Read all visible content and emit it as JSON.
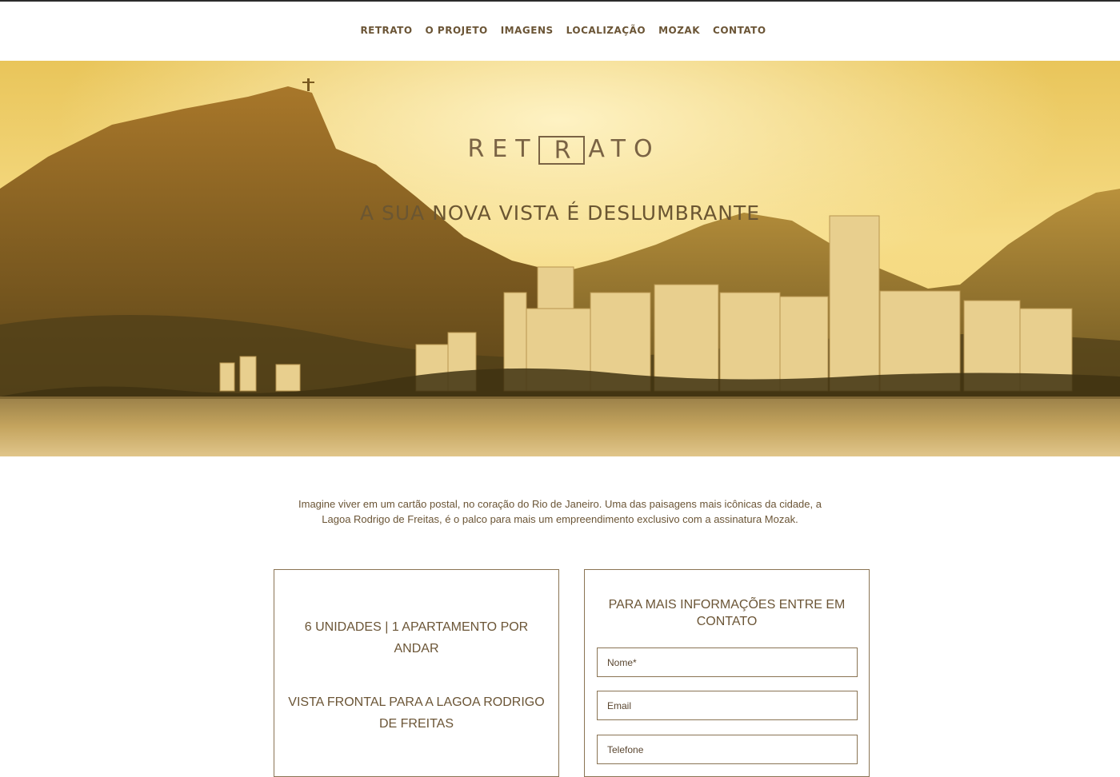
{
  "nav": {
    "items": [
      "RETRATO",
      "O PROJETO",
      "IMAGENS",
      "LOCALIZAÇÃO",
      "MOZAK",
      "CONTATO"
    ]
  },
  "hero": {
    "logo_left": "RET",
    "logo_boxed": "R",
    "logo_right": "ATO",
    "tagline": "A SUA NOVA VISTA É DESLUMBRANTE"
  },
  "intro": {
    "line1": "Imagine viver em um cartão postal, no coração do Rio de Janeiro. Uma das paisagens mais icônicas da cidade, a",
    "line2": "Lagoa Rodrigo de Freitas, é o palco para mais um empreendimento exclusivo com a assinatura Mozak."
  },
  "features": {
    "units": "6 UNIDADES | 1 APARTAMENTO POR ANDAR",
    "view": "VISTA FRONTAL PARA A LAGOA RODRIGO DE FREITAS"
  },
  "contact_form": {
    "title": "PARA MAIS INFORMAÇÕES ENTRE EM CONTATO",
    "name_placeholder": "Nome*",
    "email_placeholder": "Email",
    "phone_placeholder": "Telefone"
  },
  "colors": {
    "text": "#6b5536",
    "border": "#8a7454",
    "hero_gold": "#e8c060"
  }
}
